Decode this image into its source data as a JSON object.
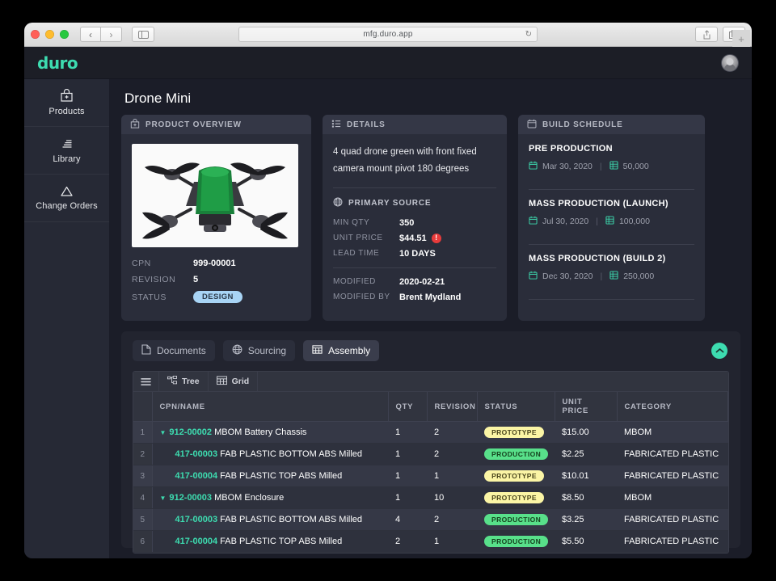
{
  "browser": {
    "url": "mfg.duro.app",
    "back_icon": "chevron-left-icon",
    "forward_icon": "chevron-right-icon",
    "sidebar_icon": "sidebar-toggle-icon",
    "reload_icon": "reload-icon",
    "share_icon": "share-icon",
    "tabs_icon": "tabs-overview-icon",
    "new_tab_label": "+"
  },
  "app": {
    "logo": "duro",
    "avatar": "user-avatar"
  },
  "sidebar": {
    "items": [
      {
        "label": "Products",
        "icon": "products-box-icon"
      },
      {
        "label": "Library",
        "icon": "library-icon"
      },
      {
        "label": "Change Orders",
        "icon": "change-orders-triangle-icon"
      }
    ]
  },
  "page": {
    "title": "Drone Mini"
  },
  "overview": {
    "header": "PRODUCT OVERVIEW",
    "header_icon": "product-box-icon",
    "image_alt": "green quadcopter drone",
    "fields": [
      {
        "key": "CPN",
        "value": "999-00001"
      },
      {
        "key": "REVISION",
        "value": "5"
      }
    ],
    "status_key": "STATUS",
    "status_value": "DESIGN"
  },
  "details": {
    "header": "DETAILS",
    "header_icon": "list-icon",
    "description": "4 quad drone green with front fixed camera mount pivot 180 degrees",
    "primary_source_label": "PRIMARY SOURCE",
    "primary_source_icon": "globe-icon",
    "source_fields": [
      {
        "key": "MIN QTY",
        "value": "350",
        "warn": false
      },
      {
        "key": "UNIT PRICE",
        "value": "$44.51",
        "warn": true
      },
      {
        "key": "LEAD TIME",
        "value": "10 DAYS",
        "warn": false
      }
    ],
    "meta_fields": [
      {
        "key": "MODIFIED",
        "value": "2020-02-21"
      },
      {
        "key": "MODIFIED BY",
        "value": "Brent Mydland"
      }
    ],
    "warn_icon": "alert-error-icon"
  },
  "schedule": {
    "header": "BUILD SCHEDULE",
    "header_icon": "calendar-icon",
    "date_icon": "calendar-icon",
    "qty_icon": "grid-quantity-icon",
    "items": [
      {
        "title": "PRE PRODUCTION",
        "date": "Mar 30, 2020",
        "qty": "50,000"
      },
      {
        "title": "MASS PRODUCTION (LAUNCH)",
        "date": "Jul 30, 2020",
        "qty": "100,000"
      },
      {
        "title": "MASS PRODUCTION (BUILD 2)",
        "date": "Dec 30, 2020",
        "qty": "250,000"
      }
    ]
  },
  "lower": {
    "tabs": [
      {
        "label": "Documents",
        "icon": "document-icon",
        "active": false
      },
      {
        "label": "Sourcing",
        "icon": "globe-icon",
        "active": false
      },
      {
        "label": "Assembly",
        "icon": "table-grid-icon",
        "active": true
      }
    ],
    "collapse_icon": "chevron-up-icon",
    "toolbar": {
      "menu_icon": "hamburger-menu-icon",
      "buttons": [
        {
          "label": "Tree",
          "icon": "tree-view-icon"
        },
        {
          "label": "Grid",
          "icon": "grid-view-icon"
        }
      ]
    },
    "table": {
      "columns": [
        "",
        "CPN/NAME",
        "QTY",
        "REVISION",
        "STATUS",
        "UNIT PRICE",
        "CATEGORY"
      ],
      "rows": [
        {
          "idx": "1",
          "expandable": true,
          "indent": false,
          "cpn": "912-00002",
          "name": "MBOM Battery Chassis",
          "qty": "1",
          "revision": "2",
          "status": "PROTOTYPE",
          "unit_price": "$15.00",
          "category": "MBOM"
        },
        {
          "idx": "2",
          "expandable": false,
          "indent": true,
          "cpn": "417-00003",
          "name": "FAB PLASTIC BOTTOM ABS Milled",
          "qty": "1",
          "revision": "2",
          "status": "PRODUCTION",
          "unit_price": "$2.25",
          "category": "FABRICATED PLASTIC"
        },
        {
          "idx": "3",
          "expandable": false,
          "indent": true,
          "cpn": "417-00004",
          "name": "FAB PLASTIC TOP ABS Milled",
          "qty": "1",
          "revision": "1",
          "status": "PROTOTYPE",
          "unit_price": "$10.01",
          "category": "FABRICATED PLASTIC"
        },
        {
          "idx": "4",
          "expandable": true,
          "indent": false,
          "cpn": "912-00003",
          "name": "MBOM Enclosure",
          "qty": "1",
          "revision": "10",
          "status": "PROTOTYPE",
          "unit_price": "$8.50",
          "category": "MBOM"
        },
        {
          "idx": "5",
          "expandable": false,
          "indent": true,
          "cpn": "417-00003",
          "name": "FAB PLASTIC BOTTOM ABS Milled",
          "qty": "4",
          "revision": "2",
          "status": "PRODUCTION",
          "unit_price": "$3.25",
          "category": "FABRICATED PLASTIC"
        },
        {
          "idx": "6",
          "expandable": false,
          "indent": true,
          "cpn": "417-00004",
          "name": "FAB PLASTIC TOP ABS Milled",
          "qty": "2",
          "revision": "1",
          "status": "PRODUCTION",
          "unit_price": "$5.50",
          "category": "FABRICATED PLASTIC"
        }
      ]
    }
  },
  "colors": {
    "accent": "#3ddcb0",
    "status_design": "#a8d4f5",
    "badge_prototype": "#fbf5a5",
    "badge_production": "#58e08a",
    "alert": "#e83b3b"
  }
}
